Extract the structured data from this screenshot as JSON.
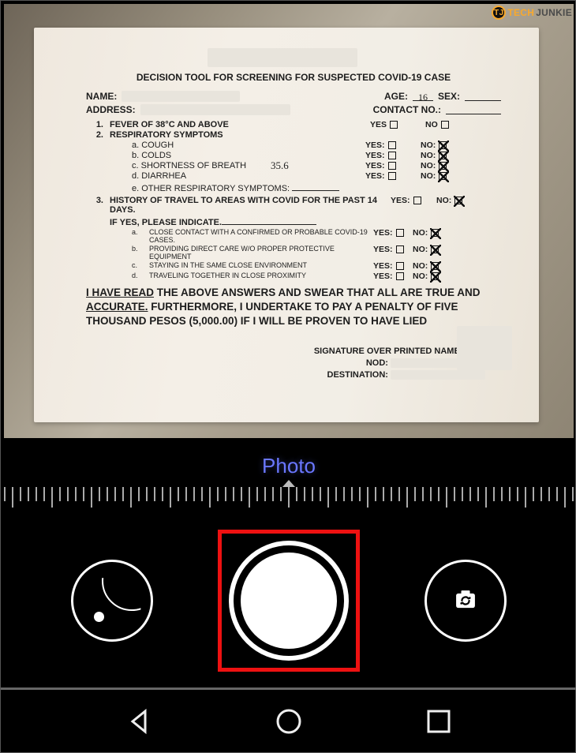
{
  "watermark": {
    "badge": "TJ",
    "word1": "TECH",
    "word2": "JUNKIE"
  },
  "doc": {
    "title": "DECISION TOOL FOR SCREENING FOR SUSPECTED COVID-19 CASE",
    "fields": {
      "name_label": "NAME:",
      "age_label": "AGE:",
      "age_value": "16",
      "sex_label": "SEX:",
      "address_label": "ADDRESS:",
      "contact_label": "CONTACT NO.:"
    },
    "col_yes": "YES",
    "col_no": "NO",
    "q1": {
      "num": "1.",
      "text": "FEVER OF 38°C AND ABOVE"
    },
    "q2": {
      "num": "2.",
      "text": "RESPIRATORY SYMPTOMS",
      "a": "a. COUGH",
      "b": "b. COLDS",
      "c": "c. SHORTNESS OF BREATH",
      "d": "d. DIARRHEA",
      "e": "e. OTHER RESPIRATORY SYMPTOMS:"
    },
    "q3": {
      "num": "3.",
      "text": "HISTORY OF TRAVEL TO AREAS WITH COVID FOR THE PAST 14 DAYS.",
      "ifyes": "IF YES, PLEASE INDICATE.",
      "a": "CLOSE CONTACT WITH A CONFIRMED OR PROBABLE COVID-19 CASES.",
      "b": "PROVIDING DIRECT CARE W/O PROPER PROTECTIVE EQUIPMENT",
      "c": "STAYING IN THE SAME CLOSE ENVIRONMENT",
      "d": "TRAVELING TOGETHER IN CLOSE PROXIMITY",
      "al": "a.",
      "bl": "b.",
      "cl": "c.",
      "dl": "d."
    },
    "temp_note": "35.6",
    "attest_1": "I HAVE READ",
    "attest_2": " THE ABOVE ANSWERS AND SWEAR THAT ALL ARE TRUE AND ",
    "attest_3": "ACCURATE.",
    "attest_4": " FURTHERMORE, I UNDERTAKE TO PAY A PENALTY OF FIVE THOUSAND PESOS (5,000.00) IF I WILL BE PROVEN TO HAVE LIED",
    "sig": "SIGNATURE OVER PRINTED NAME/DATE",
    "nod": "NOD:",
    "dest": "DESTINATION:"
  },
  "camera": {
    "mode": "Photo"
  },
  "yes_c": "YES:",
  "no_c": "NO:"
}
